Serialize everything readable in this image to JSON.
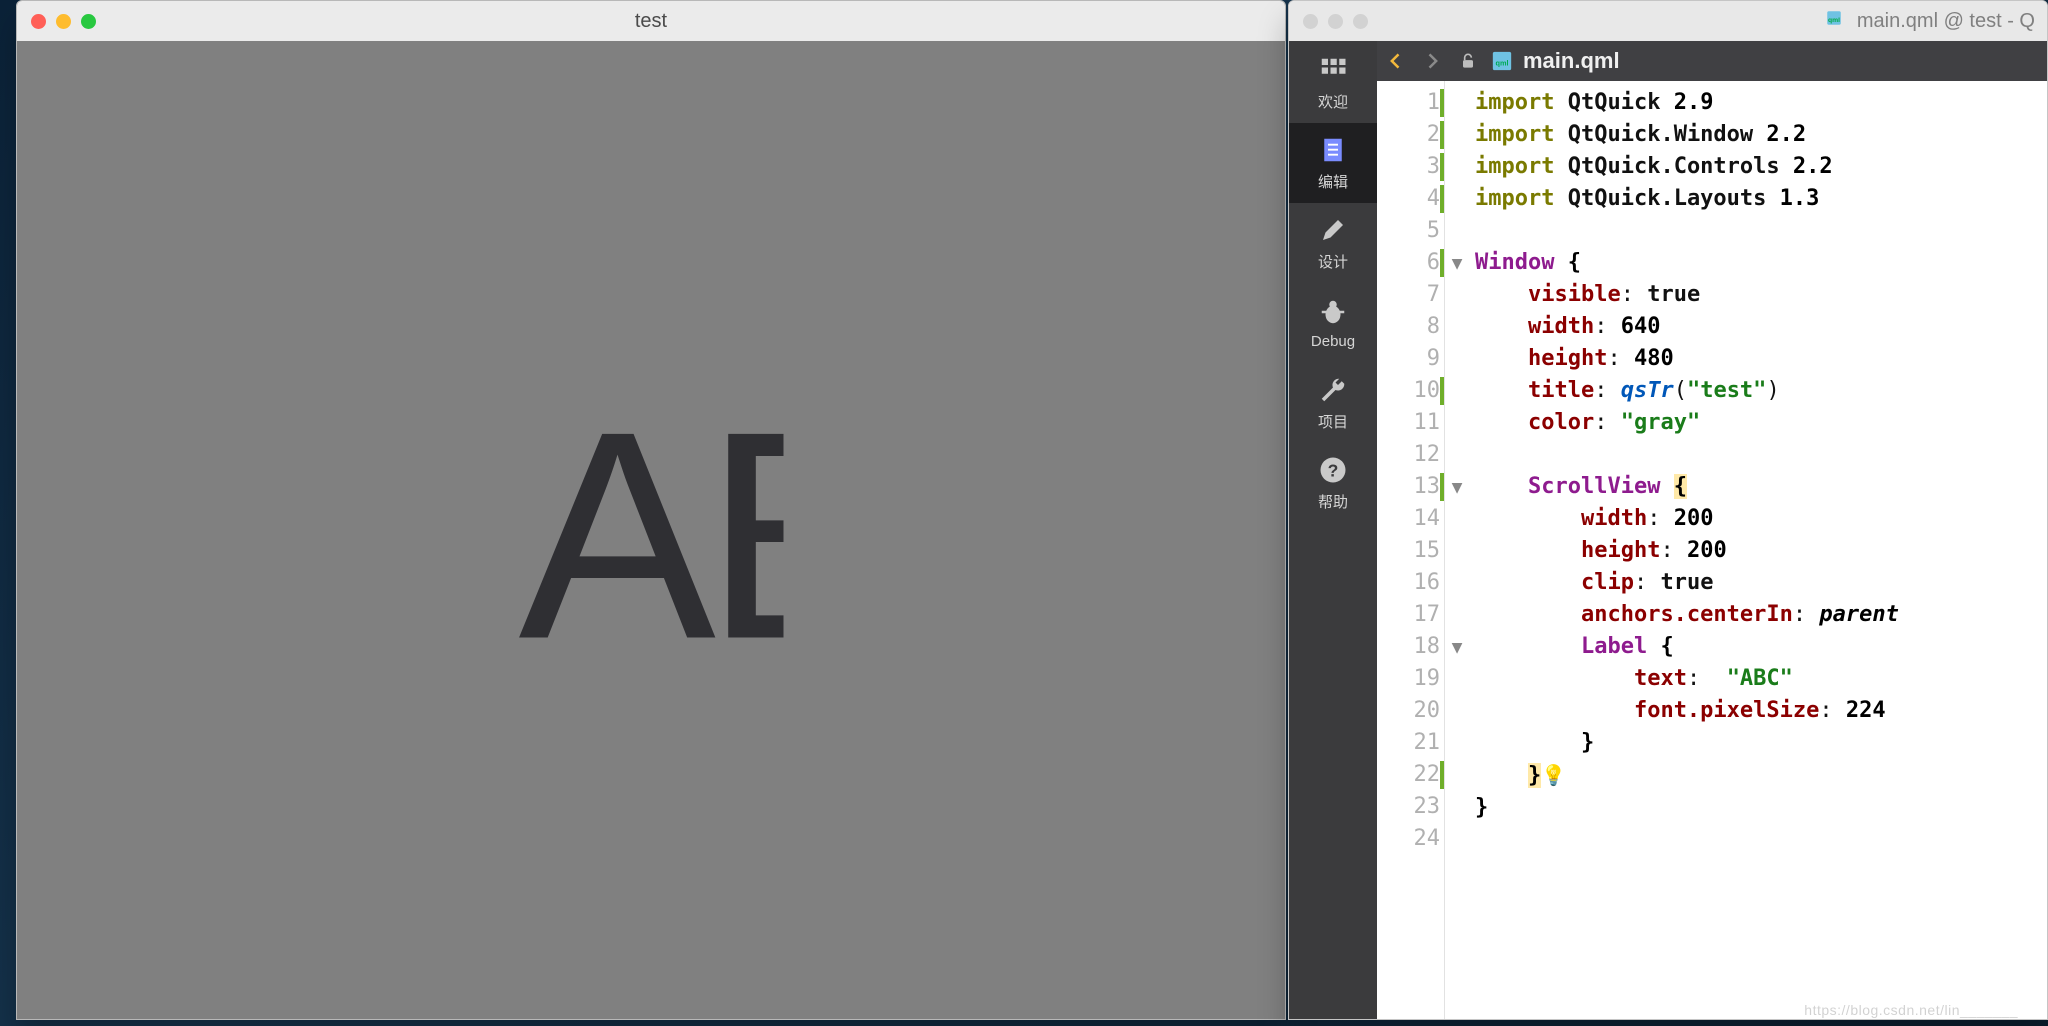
{
  "app": {
    "title": "test",
    "label_text": "ABC",
    "label_pixel_size": 224,
    "scrollview_size": 200,
    "bg_color": "gray"
  },
  "ide": {
    "window_title": "main.qml @ test - Q",
    "pathbar_file": "main.qml",
    "modes": [
      {
        "key": "welcome",
        "label": "欢迎"
      },
      {
        "key": "edit",
        "label": "编辑"
      },
      {
        "key": "design",
        "label": "设计"
      },
      {
        "key": "debug",
        "label": "Debug"
      },
      {
        "key": "projects",
        "label": "项目"
      },
      {
        "key": "help",
        "label": "帮助"
      }
    ],
    "active_mode": "edit",
    "line_numbers": [
      1,
      2,
      3,
      4,
      5,
      6,
      7,
      8,
      9,
      10,
      11,
      12,
      13,
      14,
      15,
      16,
      17,
      18,
      19,
      20,
      21,
      22,
      23,
      24
    ],
    "changed_lines": [
      1,
      2,
      3,
      4,
      6,
      10,
      13,
      22
    ],
    "fold_lines": {
      "6": "▼",
      "13": "▼",
      "18": "▼"
    },
    "code": {
      "imports": [
        {
          "module": "QtQuick",
          "version": "2.9"
        },
        {
          "module": "QtQuick.Window",
          "version": "2.2"
        },
        {
          "module": "QtQuick.Controls",
          "version": "2.2"
        },
        {
          "module": "QtQuick.Layouts",
          "version": "1.3"
        }
      ],
      "window": {
        "visible": "true",
        "width": "640",
        "height": "480",
        "title_fn": "qsTr",
        "title_arg": "\"test\"",
        "color": "\"gray\"",
        "scrollview": {
          "width": "200",
          "height": "200",
          "clip": "true",
          "anchors_centerIn": "parent",
          "label": {
            "text": "\"ABC\"",
            "font_pixelSize": "224"
          }
        }
      }
    }
  },
  "watermark": "https://blog.csdn.net/lin_______"
}
